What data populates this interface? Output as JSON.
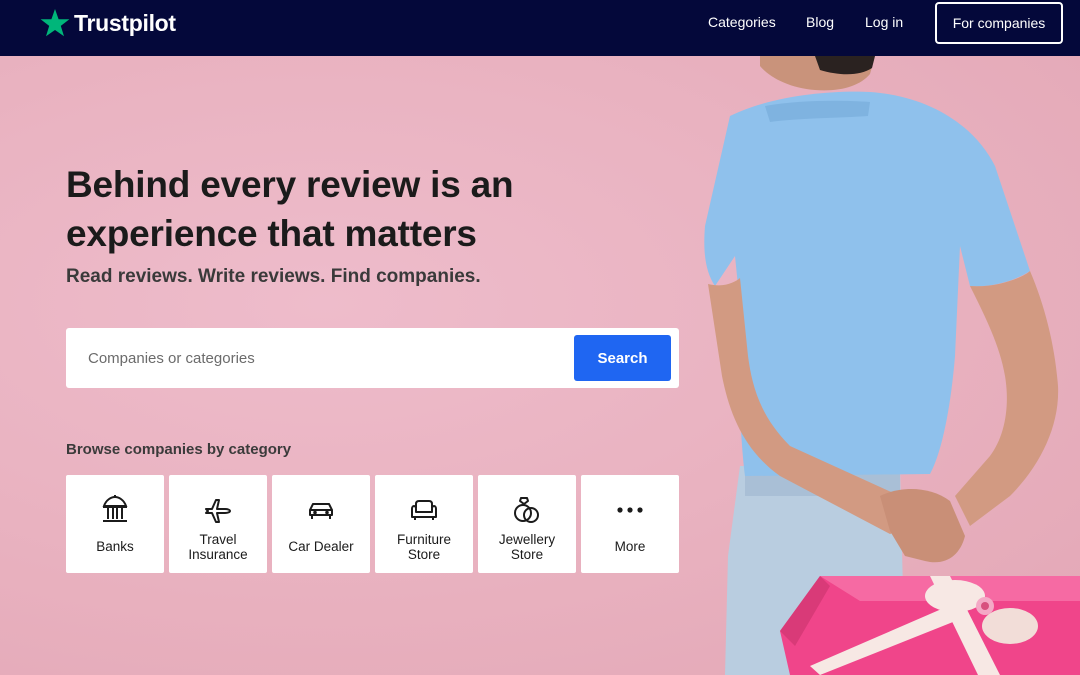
{
  "brand": {
    "name": "Trustpilot",
    "star_color": "#00b67a"
  },
  "nav": {
    "categories": "Categories",
    "blog": "Blog",
    "login": "Log in",
    "for_companies": "For companies"
  },
  "hero": {
    "headline": "Behind every review is an experience that matters",
    "subhead": "Read reviews. Write reviews. Find companies."
  },
  "search": {
    "placeholder": "Companies or categories",
    "value": "",
    "button_label": "Search"
  },
  "browse": {
    "label": "Browse companies by category",
    "categories": [
      {
        "line1": "Banks",
        "line2": "",
        "icon": "bank-icon"
      },
      {
        "line1": "Travel",
        "line2": "Insurance",
        "icon": "airplane-icon"
      },
      {
        "line1": "Car Dealer",
        "line2": "",
        "icon": "car-icon"
      },
      {
        "line1": "Furniture",
        "line2": "Store",
        "icon": "sofa-icon"
      },
      {
        "line1": "Jewellery",
        "line2": "Store",
        "icon": "rings-icon"
      },
      {
        "line1": "More",
        "line2": "",
        "icon": "more-dots-icon"
      }
    ]
  },
  "colors": {
    "nav_bg": "#04083a",
    "hero_bg": "#e9b2c0",
    "accent": "#1f66f2",
    "gift": "#f0458a",
    "shirt": "#8fc1ec"
  }
}
